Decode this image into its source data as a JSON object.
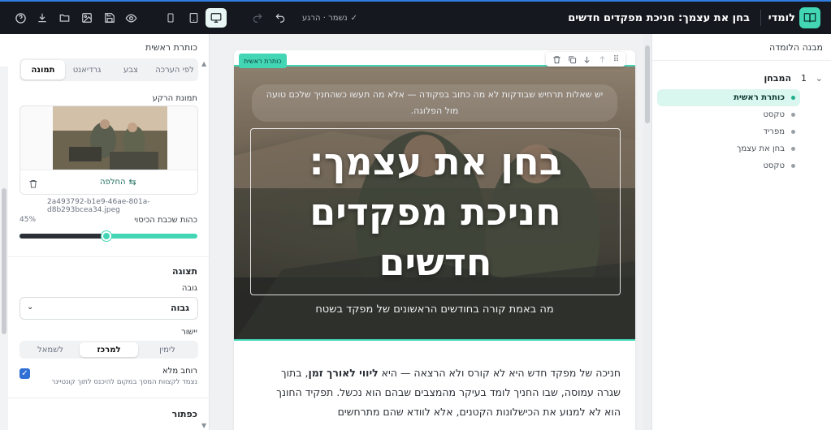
{
  "topbar": {
    "logo_text": "לומדי",
    "doc_title": "בחן את עצמך: חניכת מפקדים חדשים",
    "save_status": "נשמר · הרגע",
    "icons": [
      "help-icon",
      "download-icon",
      "folder-icon",
      "image-icon",
      "save-icon",
      "preview-icon"
    ],
    "devices": [
      "mobile",
      "tablet",
      "desktop"
    ],
    "active_device": "desktop"
  },
  "left_panel": {
    "title": "כותרת ראשית",
    "bg_tabs": [
      "לפי הערכה",
      "צבע",
      "גרדיאנט",
      "תמונה"
    ],
    "active_bg_tab": "תמונה",
    "bg_image_label": "תמונת הרקע",
    "replace_label": "החלפה",
    "file_name": "2a493792-b1e9-46ae-801a-d8b293bcea34.jpeg",
    "overlay_label": "כהות שכבת הכיסוי",
    "overlay_value": "45%",
    "overlay_fraction": 0.45,
    "display_section": "תצוגה",
    "height_label": "גובה",
    "height_value": "גבוה",
    "align_label": "יישור",
    "align_options": [
      "לימין",
      "למרכז",
      "לשמאל"
    ],
    "align_active": "למרכז",
    "fullwidth_label": "רוחב מלא",
    "fullwidth_desc": "נצמד לקצוות המסך במקום להיכנס לתוך קונטיינר",
    "fullwidth_checked": true,
    "button_section": "כפתור"
  },
  "canvas": {
    "tag": "כותרת ראשית",
    "hero_subtitle": "יש שאלות תרחיש שבודקות לא מה כתוב בפקודה — אלא מה תעשו כשהחניך שלכם טועה מול הפלוגה.",
    "hero_title": "בחן את עצמך: חניכת מפקדים חדשים",
    "hero_caption": "מה באמת קורה בחודשים הראשונים של מפקד בשטח",
    "body_pre": "חניכה של מפקד חדש היא לא קורס ולא הרצאה — היא ",
    "body_bold": "ליווי לאורך זמן",
    "body_post": ", בתוך שגרה עמוסה, שבו החניך לומד בעיקר מהמצבים שבהם הוא נכשל. תפקיד החונך הוא לא למנוע את הכישלונות הקטנים, אלא לוודא שהם מתרחשים"
  },
  "right_panel": {
    "title": "מבנה הלומדה",
    "tree_number": "1",
    "tree_title": "המבחן",
    "items": [
      "כותרת ראשית",
      "טקסט",
      "מפריד",
      "בחן את עצמך",
      "טקסט"
    ],
    "active_index": 0
  }
}
